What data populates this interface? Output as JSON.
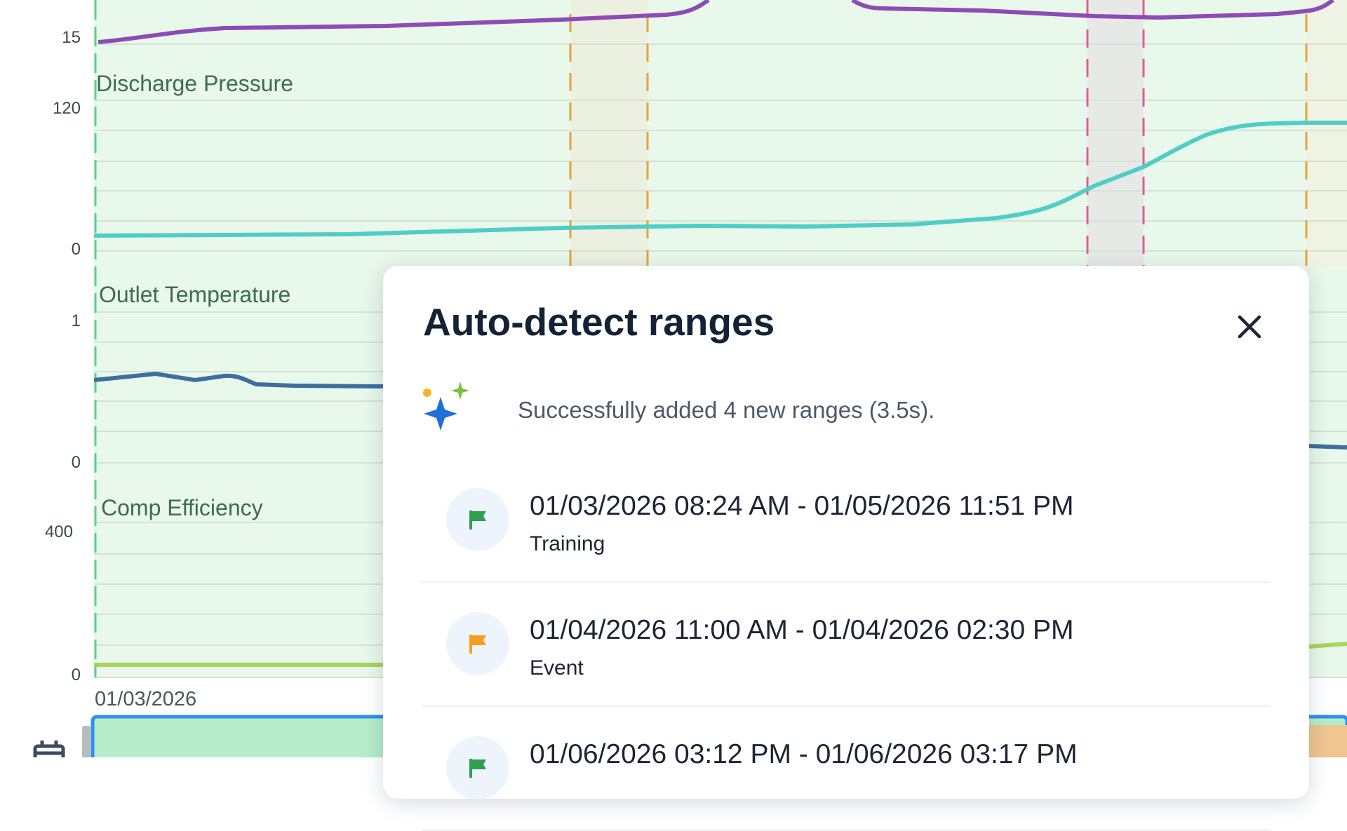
{
  "charts": [
    {
      "name": "Discharge Pressure",
      "y_max_label": "120",
      "y_min_label": "0"
    },
    {
      "name": "Outlet Temperature",
      "y_max_label": "1",
      "y_min_label": "0"
    },
    {
      "name": "Comp Efficiency",
      "y_max_label": "400",
      "y_min_label": "0"
    }
  ],
  "top_partial_tick": "15",
  "x_axis": {
    "start_label": "01/03/2026"
  },
  "series_colors": {
    "top": "#8e4bb5",
    "discharge_pressure": "#4fcdc6",
    "outlet_temperature": "#3f6e9e",
    "comp_efficiency": "#a6d65a"
  },
  "dialog": {
    "title": "Auto-detect ranges",
    "success_message": "Successfully added 4 new ranges (3.5s).",
    "ranges": [
      {
        "dates": "01/03/2026 08:24 AM - 01/05/2026 11:51 PM",
        "type": "Training",
        "icon": "flag-icon",
        "color": "#2e9e4f"
      },
      {
        "dates": "01/04/2026 11:00 AM - 01/04/2026 02:30 PM",
        "type": "Event",
        "icon": "flag-icon",
        "color": "#f5a020"
      },
      {
        "dates": "01/06/2026 03:12 PM - 01/06/2026 03:17 PM",
        "type": "",
        "icon": "flag-icon",
        "color": "#2e9e4f"
      }
    ]
  }
}
